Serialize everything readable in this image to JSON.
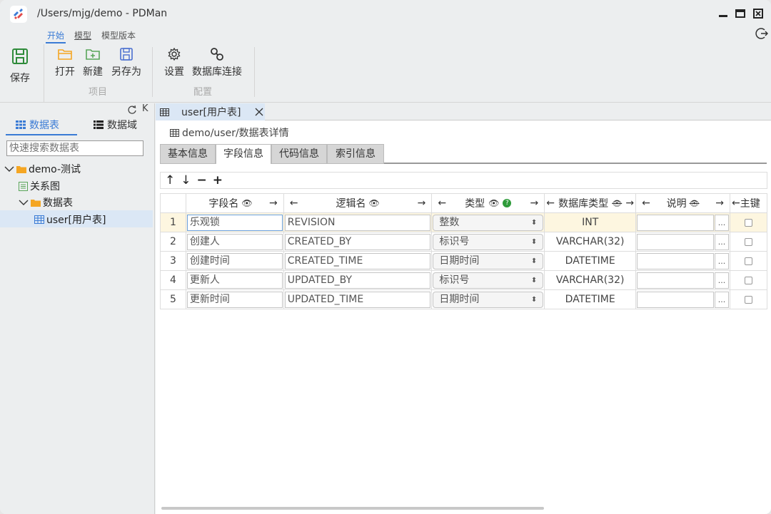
{
  "window": {
    "title": "/Users/mjg/demo - PDMan"
  },
  "menu": {
    "items": [
      "开始",
      "模型",
      "模型版本"
    ]
  },
  "ribbon": {
    "save": "保存",
    "open": "打开",
    "new": "新建",
    "save_as": "另存为",
    "project_group": "项目",
    "settings": "设置",
    "db_connect": "数据库连接",
    "config_group": "配置"
  },
  "sidebar": {
    "tab_tables": "数据表",
    "tab_domains": "数据域",
    "search_placeholder": "快速搜索数据表",
    "tree": {
      "root": "demo-测试",
      "relation": "关系图",
      "folder": "数据表",
      "table": "user[用户表]"
    },
    "collapse_label": "K"
  },
  "doc_tab": {
    "label": "user[用户表]"
  },
  "breadcrumb": "demo/user/数据表详情",
  "subtabs": [
    "基本信息",
    "字段信息",
    "代码信息",
    "索引信息"
  ],
  "toolbar": {
    "up": "↑",
    "down": "↓",
    "remove": "−",
    "add": "+"
  },
  "columns": {
    "field_name": "字段名",
    "logic_name": "逻辑名",
    "type": "类型",
    "db_type": "数据库类型",
    "desc": "说明",
    "pk": "主键"
  },
  "rows": [
    {
      "num": "1",
      "field": "乐观锁",
      "logic": "REVISION",
      "type": "整数",
      "db_type": "INT"
    },
    {
      "num": "2",
      "field": "创建人",
      "logic": "CREATED_BY",
      "type": "标识号",
      "db_type": "VARCHAR(32)"
    },
    {
      "num": "3",
      "field": "创建时间",
      "logic": "CREATED_TIME",
      "type": "日期时间",
      "db_type": "DATETIME"
    },
    {
      "num": "4",
      "field": "更新人",
      "logic": "UPDATED_BY",
      "type": "标识号",
      "db_type": "VARCHAR(32)"
    },
    {
      "num": "5",
      "field": "更新时间",
      "logic": "UPDATED_TIME",
      "type": "日期时间",
      "db_type": "DATETIME"
    }
  ],
  "dots_label": "...",
  "colors": {
    "accent": "#3a7bd5",
    "save_green": "#2e8b3a",
    "folder_orange": "#f5a623",
    "row_highlight": "#fdf6e0"
  }
}
